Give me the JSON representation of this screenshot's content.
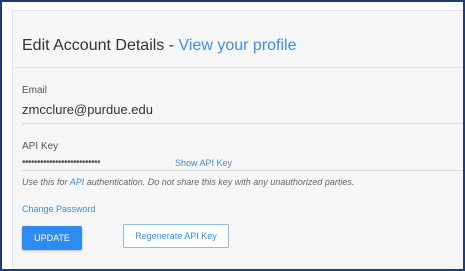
{
  "header": {
    "title": "Edit Account Details",
    "separator": " - ",
    "profile_link": "View your profile"
  },
  "email": {
    "label": "Email",
    "value": "zmcclure@purdue.edu"
  },
  "api_key": {
    "label": "API Key",
    "masked_value": "••••••••••••••••••••••••••",
    "show_link": "Show API Key",
    "hint_before": "Use this for ",
    "hint_link": "API",
    "hint_after": " authentication. Do not share this key with any unauthorized parties."
  },
  "change_password_link": "Change Password",
  "buttons": {
    "update": "UPDATE",
    "regenerate": "Regenerate API Key"
  },
  "colors": {
    "link": "#3a8ee6",
    "primary_button": "#2d8cf0",
    "frame_border": "#1f3d73"
  }
}
